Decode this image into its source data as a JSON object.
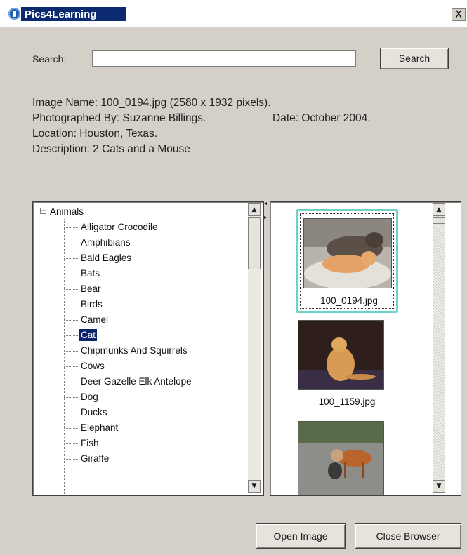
{
  "window": {
    "title": "Pics4Learning",
    "close_label": "X"
  },
  "search": {
    "label": "Search:",
    "value": "",
    "placeholder": "",
    "button_label": "Search"
  },
  "image_info": {
    "name_line": "Image Name: 100_0194.jpg (2580 x 1932 pixels).",
    "photographer_line": "Photographed By: Suzanne Billings.",
    "date_line": "Date: October 2004.",
    "location_line": "Location: Houston, Texas.",
    "description_line": "Description: 2 Cats and a Mouse"
  },
  "tree": {
    "root_toggle": "−",
    "root_label": "Animals",
    "items": [
      "Alligator Crocodile",
      "Amphibians",
      "Bald Eagles",
      "Bats",
      "Bear",
      "Birds",
      "Camel",
      "Cat",
      "Chipmunks And Squirrels",
      "Cows",
      "Deer Gazelle Elk Antelope",
      "Dog",
      "Ducks",
      "Elephant",
      "Fish",
      "Giraffe"
    ],
    "selected_item": "Cat"
  },
  "thumbnails": [
    {
      "caption": "100_0194.jpg",
      "selected": true
    },
    {
      "caption": "100_1159.jpg",
      "selected": false
    },
    {
      "caption": "",
      "selected": false
    }
  ],
  "buttons": {
    "open_image": "Open Image",
    "close_browser": "Close Browser"
  },
  "scroll_glyphs": {
    "up": "▲",
    "down": "▼"
  },
  "colors": {
    "title_bar": "#0b2a6f",
    "selection": "#0a246a",
    "thumb_highlight": "#6fd1c8",
    "window_bg": "#d4d0c8"
  }
}
